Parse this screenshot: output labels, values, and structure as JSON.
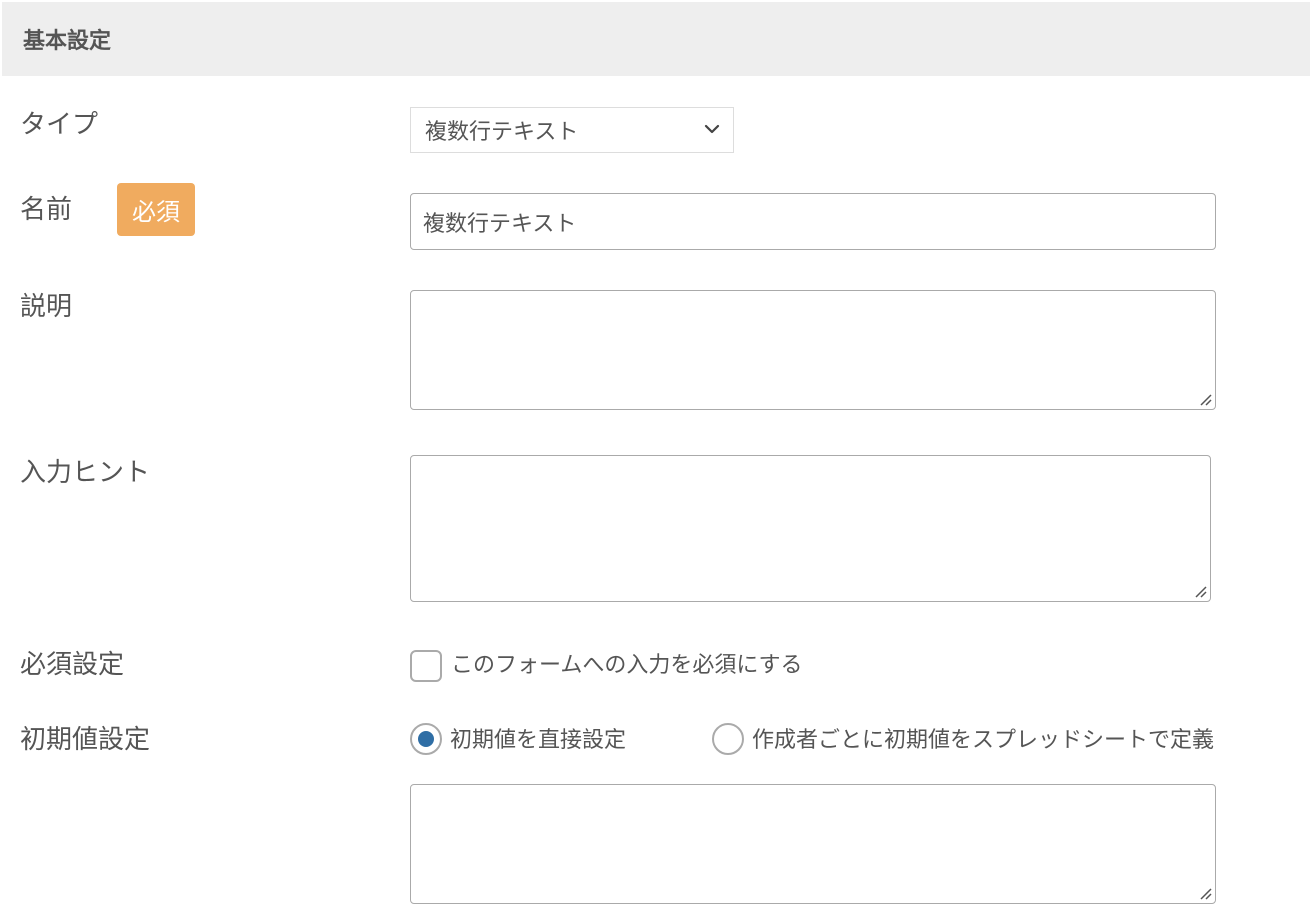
{
  "section": {
    "title": "基本設定"
  },
  "fields": {
    "type": {
      "label": "タイプ",
      "value": "複数行テキスト"
    },
    "name": {
      "label": "名前",
      "badge": "必須",
      "value": "複数行テキスト"
    },
    "description": {
      "label": "説明"
    },
    "hint": {
      "label": "入力ヒント"
    },
    "required": {
      "label": "必須設定",
      "checkbox_label": "このフォームへの入力を必須にする",
      "checked": false
    },
    "initial": {
      "label": "初期値設定",
      "option_direct": "初期値を直接設定",
      "option_spreadsheet": "作成者ごとに初期値をスプレッドシートで定義",
      "selected": "option_direct"
    }
  },
  "colors": {
    "badge": "#f0ab5f",
    "radio_selected": "#2f6ea5",
    "header_bg": "#eeeeee"
  },
  "icons": {
    "select_arrow": "chevron-down-icon",
    "resize": "resize-handle-icon"
  }
}
